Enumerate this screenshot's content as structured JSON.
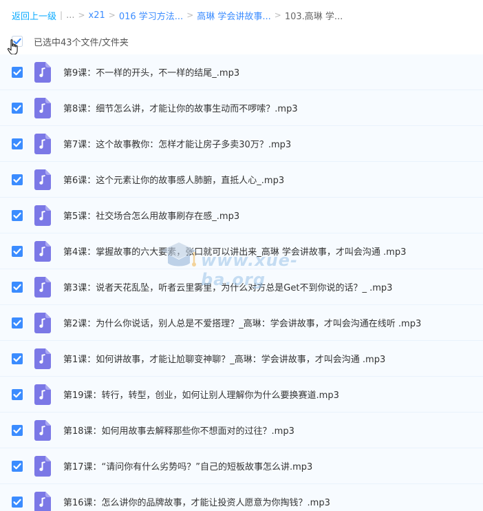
{
  "breadcrumb": {
    "back": "返回上一级",
    "ellipsis": "...",
    "items": [
      "x21",
      "016 学习方法...",
      "高琳 学会讲故事..."
    ],
    "current": "103.高琳 学..."
  },
  "selection": {
    "label": "已选中43个文件/文件夹"
  },
  "files": [
    {
      "name": "第9课：不一样的开头，不一样的结尾_.mp3"
    },
    {
      "name": "第8课：细节怎么讲，才能让你的故事生动而不啰嗦？.mp3"
    },
    {
      "name": "第7课：这个故事教你：怎样才能让房子多卖30万？.mp3"
    },
    {
      "name": "第6课：这个元素让你的故事感人肺腑，直抵人心_.mp3"
    },
    {
      "name": "第5课：社交场合怎么用故事刷存在感_.mp3"
    },
    {
      "name": "第4课：掌握故事的六大要素，张口就可以讲出来_高琳 学会讲故事，才叫会沟通 .mp3"
    },
    {
      "name": "第3课：说者天花乱坠，听者云里雾里，为什么对方总是Get不到你说的话？_ .mp3"
    },
    {
      "name": "第2课：为什么你说话，别人总是不爱搭理？_高琳：学会讲故事，才叫会沟通在线听 .mp3"
    },
    {
      "name": "第1课：如何讲故事，才能让尬聊变神聊？_高琳：学会讲故事，才叫会沟通 .mp3"
    },
    {
      "name": "第19课：转行，转型，创业，如何让别人理解你为什么要换赛道.mp3"
    },
    {
      "name": "第18课：如何用故事去解释那些你不想面对的过往？.mp3"
    },
    {
      "name": "第17课：“请问你有什么劣势吗？”自己的短板故事怎么讲.mp3"
    },
    {
      "name": "第16课：怎么讲你的品牌故事，才能让投资人愿意为你掏钱？.mp3"
    }
  ],
  "watermark": "www.xue-ba.org",
  "colors": {
    "accent": "#3b8cff",
    "link": "#09aaff",
    "row_bg": "#f7fbff",
    "file_icon": "#7b78e6"
  }
}
